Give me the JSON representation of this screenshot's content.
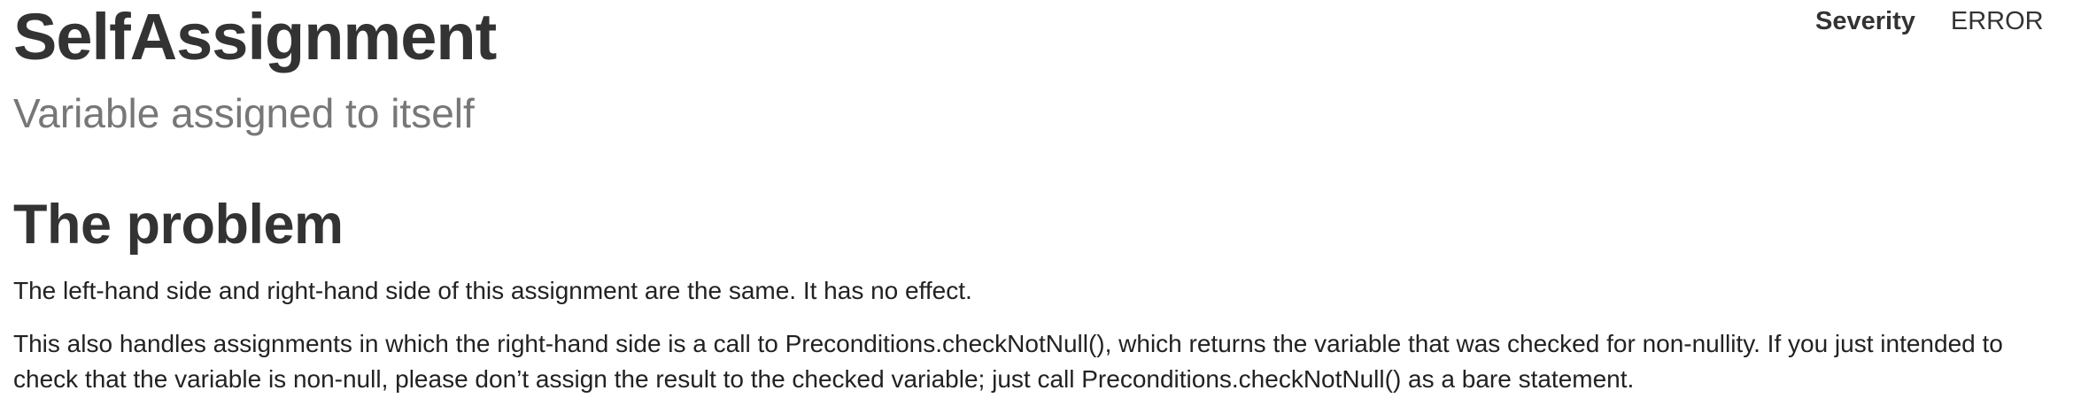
{
  "header": {
    "title": "SelfAssignment",
    "subtitle": "Variable assigned to itself"
  },
  "meta": {
    "severity_label": "Severity",
    "severity_value": "ERROR"
  },
  "section": {
    "heading": "The problem",
    "paragraphs": [
      "The left-hand side and right-hand side of this assignment are the same. It has no effect.",
      "This also handles assignments in which the right-hand side is a call to Preconditions.checkNotNull(), which returns the variable that was checked for non-nullity. If you just intended to check that the variable is non-null, please don’t assign the result to the checked variable; just call Preconditions.checkNotNull() as a bare statement."
    ]
  }
}
